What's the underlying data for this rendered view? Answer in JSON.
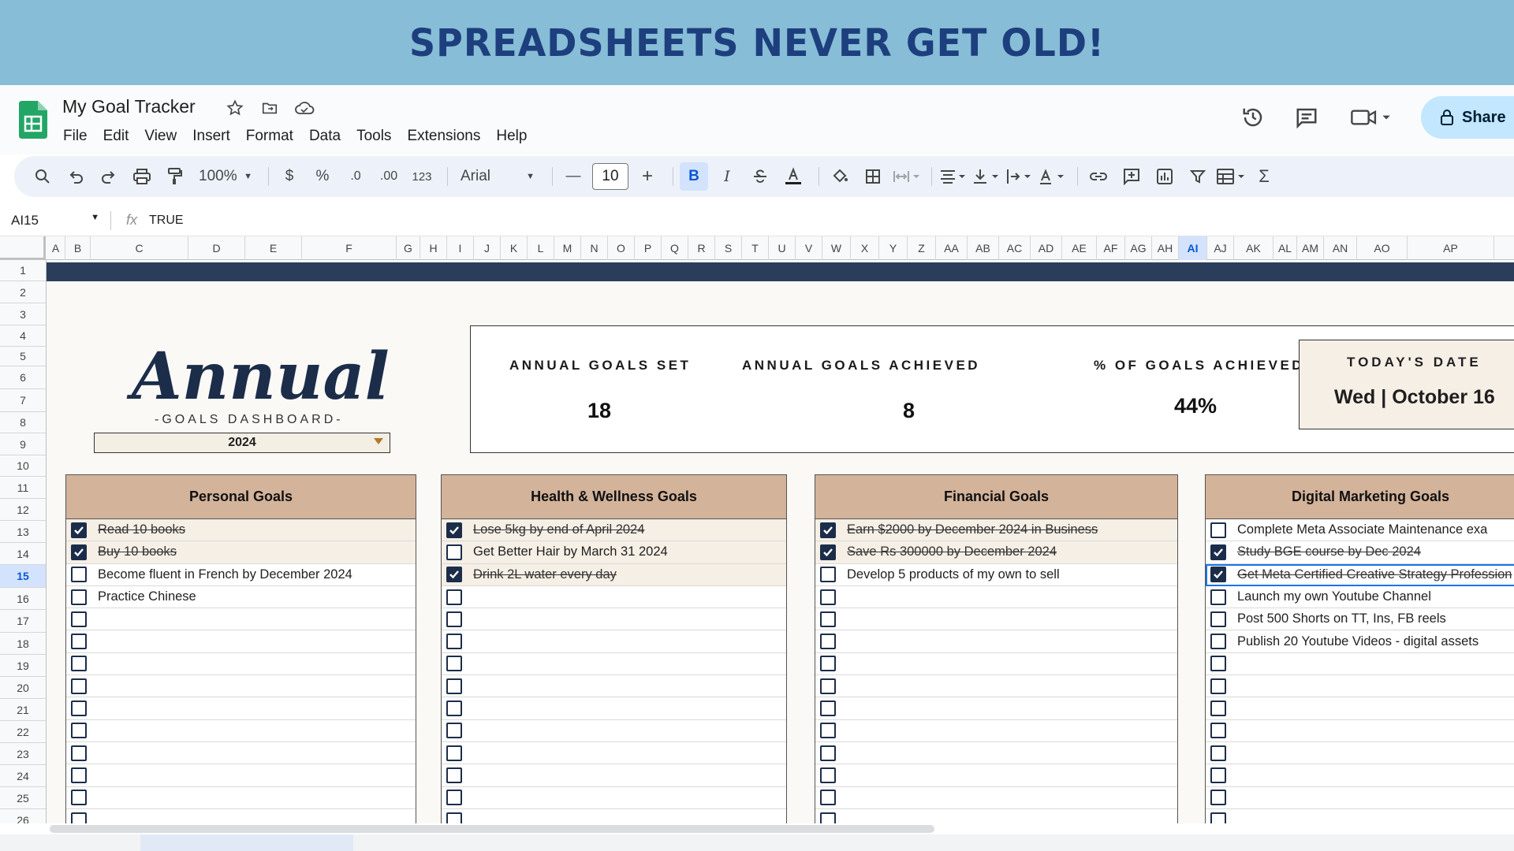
{
  "banner": {
    "text": "SPREADSHEETS NEVER GET OLD!"
  },
  "app": {
    "title": "My Goal Tracker",
    "menu": [
      "File",
      "Edit",
      "View",
      "Insert",
      "Format",
      "Data",
      "Tools",
      "Extensions",
      "Help"
    ],
    "share_label": "Share",
    "icons": [
      "star-icon",
      "move-folder-icon",
      "cloud-status-icon",
      "history-icon",
      "comment-icon",
      "meet-icon",
      "lock-icon"
    ]
  },
  "toolbar": {
    "zoom": "100%",
    "currency": "$",
    "percent": "%",
    "dec_decrease": ".0",
    "dec_increase": ".00",
    "number_format": "123",
    "font": "Arial",
    "font_size": "10",
    "bold": "B",
    "italic": "I"
  },
  "formula_bar": {
    "cell": "AI15",
    "value": "TRUE"
  },
  "columns": [
    "A",
    "B",
    "C",
    "D",
    "E",
    "F",
    "G",
    "H",
    "I",
    "J",
    "K",
    "L",
    "M",
    "N",
    "O",
    "P",
    "Q",
    "R",
    "S",
    "T",
    "U",
    "V",
    "W",
    "X",
    "Y",
    "Z",
    "AA",
    "AB",
    "AC",
    "AD",
    "AE",
    "AF",
    "AG",
    "AH",
    "AI",
    "AJ",
    "AK",
    "AL",
    "AM",
    "AN",
    "AO",
    "AP"
  ],
  "selected_column": "AI",
  "rows": [
    "1",
    "2",
    "3",
    "4",
    "5",
    "6",
    "7",
    "8",
    "9",
    "10",
    "11",
    "12",
    "13",
    "14",
    "15",
    "16",
    "17",
    "18",
    "19",
    "20",
    "21",
    "22",
    "23",
    "24",
    "25",
    "26"
  ],
  "selected_row": "15",
  "dashboard": {
    "title": "Annual",
    "subtitle": "-GOALS DASHBOARD-",
    "year": "2024",
    "stats": {
      "set_label": "ANNUAL GOALS SET",
      "set_value": "18",
      "achieved_label": "ANNUAL GOALS ACHIEVED",
      "achieved_value": "8",
      "pct_label": "% OF GOALS ACHIEVED",
      "pct_value": "44%",
      "date_label": "TODAY'S DATE",
      "date_value": "Wed |  October 16"
    },
    "panels": [
      {
        "title": "Personal Goals",
        "goals": [
          {
            "text": "Read 10 books",
            "done": true
          },
          {
            "text": "Buy 10 books",
            "done": true
          },
          {
            "text": "Become fluent in French by December 2024",
            "done": false
          },
          {
            "text": "Practice Chinese",
            "done": false
          }
        ]
      },
      {
        "title": "Health & Wellness Goals",
        "goals": [
          {
            "text": "Lose 5kg by end of April 2024",
            "done": true
          },
          {
            "text": "Get Better Hair by March 31 2024",
            "done": false
          },
          {
            "text": "Drink 2L water every day",
            "done": true
          }
        ]
      },
      {
        "title": "Financial Goals",
        "goals": [
          {
            "text": "Earn $2000 by December 2024 in Business",
            "done": true
          },
          {
            "text": "Save Rs 300000 by December 2024",
            "done": true
          },
          {
            "text": "Develop 5 products of my own to sell",
            "done": false
          }
        ]
      },
      {
        "title": "Digital Marketing Goals",
        "goals": [
          {
            "text": "Complete Meta Associate Maintenance exa",
            "done": false
          },
          {
            "text": "Study BGE course by Dec 2024",
            "done": true
          },
          {
            "text": "Get Meta Certified Creative Strategy Profession",
            "done": true
          },
          {
            "text": "Launch my own Youtube Channel",
            "done": false
          },
          {
            "text": "Post 500 Shorts on TT, Ins, FB reels",
            "done": false
          },
          {
            "text": "Publish 20 Youtube Videos - digital assets",
            "done": false
          }
        ]
      }
    ]
  }
}
